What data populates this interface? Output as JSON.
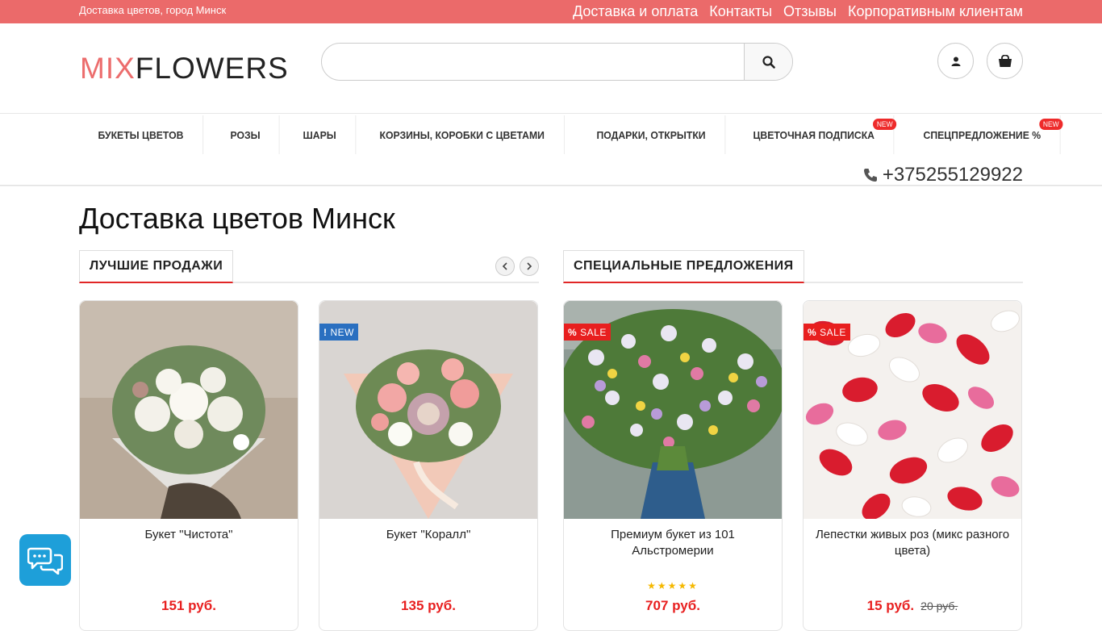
{
  "topbar": {
    "city": "Доставка цветов, город Минск",
    "links": [
      "Доставка и оплата",
      "Контакты",
      "Отзывы",
      "Корпоративным клиентам"
    ]
  },
  "header": {
    "logo_mix": "MIX",
    "logo_flowers": "FLOWERS",
    "search_placeholder": "",
    "icons": [
      "search-icon",
      "user-icon",
      "cart-icon"
    ]
  },
  "nav": {
    "items": [
      {
        "label": "БУКЕТЫ ЦВЕТОВ",
        "badge": ""
      },
      {
        "label": "РОЗЫ",
        "badge": ""
      },
      {
        "label": "ШАРЫ",
        "badge": ""
      },
      {
        "label": "КОРЗИНЫ, КОРОБКИ С ЦВЕТАМИ",
        "badge": ""
      },
      {
        "label": "ПОДАРКИ, ОТКРЫТКИ",
        "badge": ""
      },
      {
        "label": "ЦВЕТОЧНАЯ ПОДПИСКА",
        "badge": "NEW"
      },
      {
        "label": "СПЕЦПРЕДЛОЖЕНИЕ %",
        "badge": "NEW"
      }
    ],
    "phone": "+375255129922"
  },
  "main": {
    "title": "Доставка цветов Минск",
    "bestsellers": {
      "heading": "ЛУЧШИЕ ПРОДАЖИ",
      "products": [
        {
          "name": "Букет \"Чистота\"",
          "price": "151 руб.",
          "label": ""
        },
        {
          "name": "Букет \"Коралл\"",
          "price": "135 руб.",
          "label": "NEW"
        }
      ]
    },
    "specials": {
      "heading": "СПЕЦИАЛЬНЫЕ ПРЕДЛОЖЕНИЯ",
      "products": [
        {
          "name": "Премиум букет из 101 Альстромерии",
          "price": "707 руб.",
          "label": "SALE",
          "rating": 5
        },
        {
          "name": "Лепестки живых роз (микс разного цвета)",
          "price": "15 руб.",
          "old_price": "20 руб.",
          "label": "SALE"
        }
      ]
    }
  },
  "colors": {
    "topbar": "#eb6a6a",
    "accent_red": "#e81f1f",
    "new_badge": "#2a6fc0",
    "chat": "#1e9fd9"
  }
}
